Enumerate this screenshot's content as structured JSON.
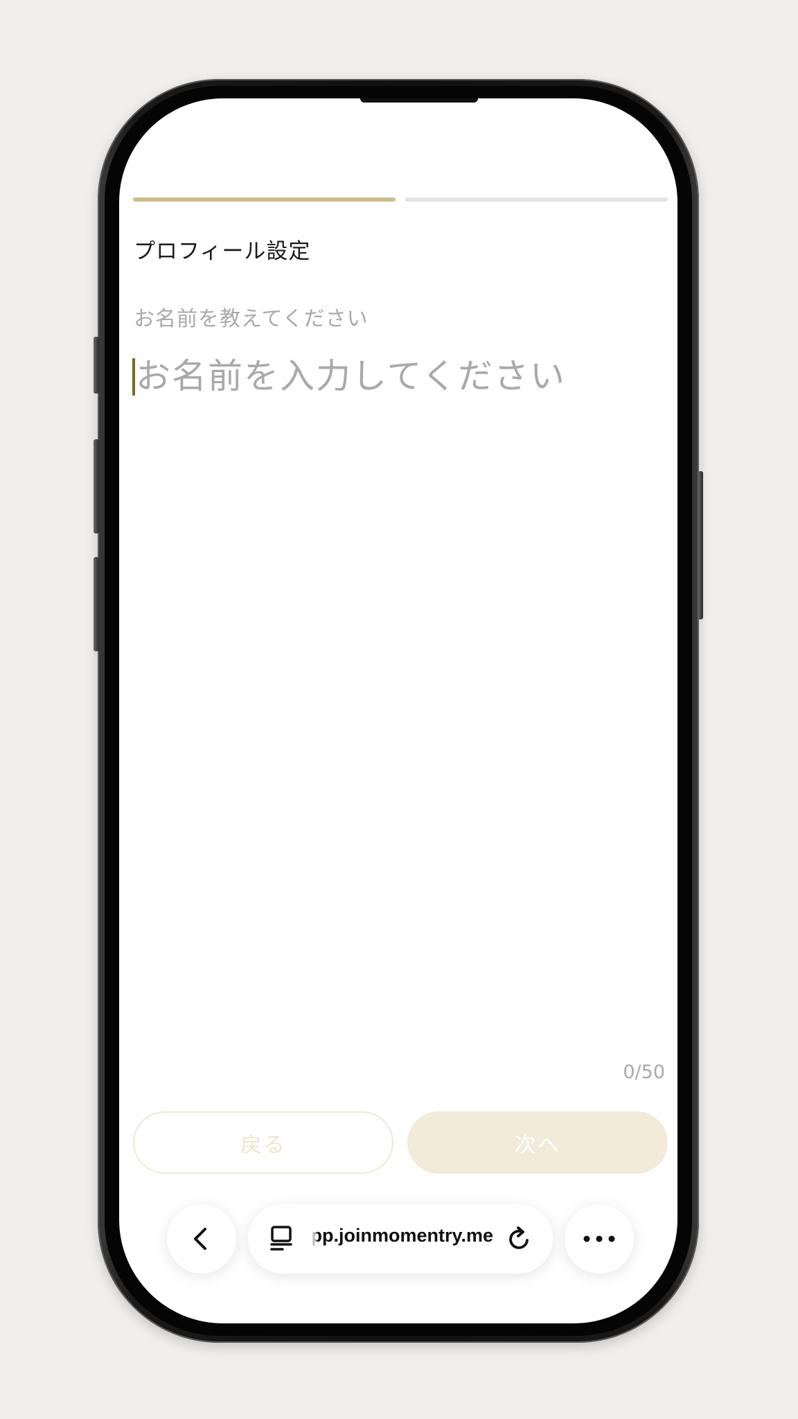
{
  "progress": {
    "steps": [
      {
        "state": "active"
      },
      {
        "state": "inactive"
      }
    ],
    "active_color": "#cdbd8d",
    "inactive_color": "#e3e3e3"
  },
  "page": {
    "title": "プロフィール設定",
    "subtitle": "お名前を教えてください"
  },
  "name_field": {
    "value": "",
    "placeholder": "お名前を入力してください",
    "counter": "0/50",
    "caret_color": "#7a6722"
  },
  "actions": {
    "back_label": "戻る",
    "next_label": "次へ"
  },
  "browser": {
    "url": "app.joinmomentry.me",
    "icons": [
      "back-chevron-icon",
      "tabs-icon",
      "reload-icon",
      "more-icon"
    ]
  }
}
